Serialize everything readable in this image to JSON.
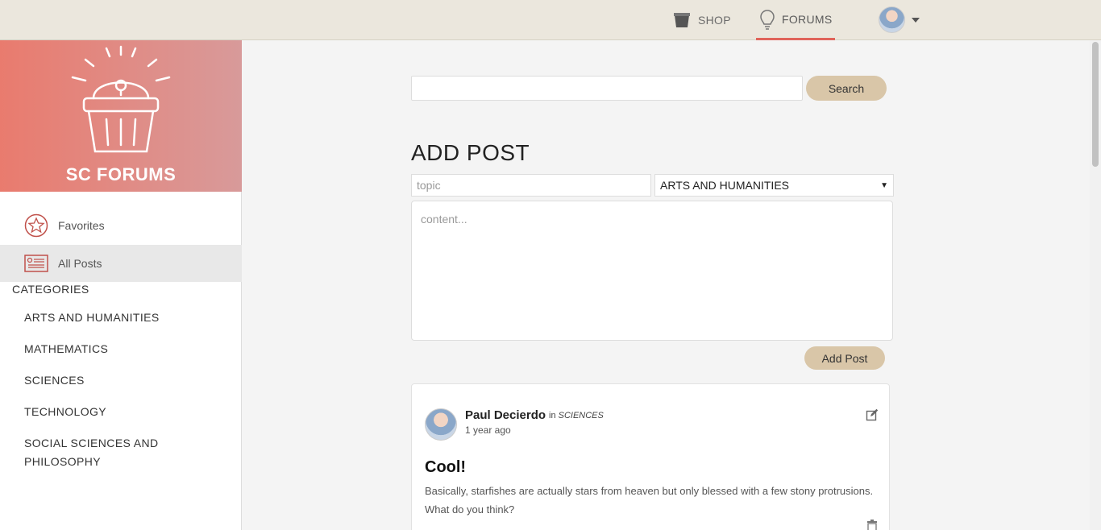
{
  "topnav": {
    "shop_label": "SHOP",
    "forums_label": "FORUMS",
    "accent_color": "#e0645a"
  },
  "sidebar": {
    "brand_title": "SC FORUMS",
    "links": [
      {
        "label": "Favorites",
        "icon": "star-icon"
      },
      {
        "label": "All Posts",
        "icon": "list-icon",
        "active": true
      }
    ],
    "categories_heading": "CATEGORIES",
    "categories": [
      "ARTS AND HUMANITIES",
      "MATHEMATICS",
      "SCIENCES",
      "TECHNOLOGY",
      "SOCIAL SCIENCES AND PHILOSOPHY"
    ]
  },
  "search": {
    "value": "",
    "button_label": "Search"
  },
  "add_post": {
    "title": "ADD POST",
    "topic_placeholder": "topic",
    "category_selected": "ARTS AND HUMANITIES",
    "content_placeholder": "content...",
    "button_label": "Add Post"
  },
  "post": {
    "author": "Paul Decierdo",
    "in_label": "in",
    "category": "SCIENCES",
    "time": "1 year ago",
    "title": "Cool!",
    "body": "Basically, starfishes are actually stars from heaven but only blessed with a few stony protrusions. What do you think?"
  },
  "colors": {
    "button_bg": "#d9c6a8",
    "brand_gradient_start": "#e97b6e",
    "brand_gradient_end": "#d89a9a",
    "topbar_bg": "#ebe7dd"
  }
}
